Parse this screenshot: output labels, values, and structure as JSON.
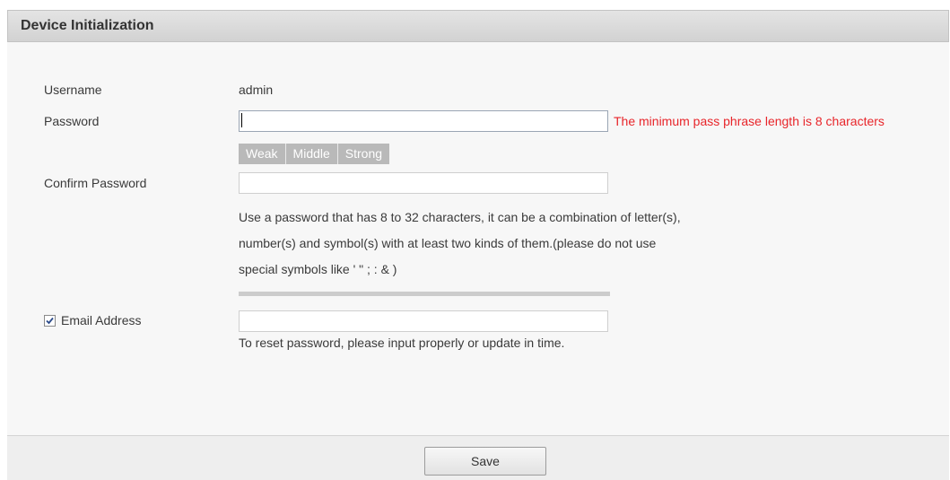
{
  "window": {
    "title": "Device Initialization"
  },
  "form": {
    "username": {
      "label": "Username",
      "value": "admin"
    },
    "password": {
      "label": "Password",
      "value": "",
      "error": "The minimum pass phrase length is 8 characters",
      "strength_levels": [
        "Weak",
        "Middle",
        "Strong"
      ]
    },
    "confirm_password": {
      "label": "Confirm Password",
      "value": ""
    },
    "hint_lines": [
      "Use a password that has 8 to 32 characters, it can be a combination of letter(s),",
      "number(s) and symbol(s) with at least two kinds of them.(please do not use",
      "special symbols like ' \" ; : & )"
    ],
    "email": {
      "label": "Email Address",
      "checked": true,
      "value": "",
      "hint": "To reset password, please input properly or update in time."
    }
  },
  "footer": {
    "save_label": "Save"
  },
  "colors": {
    "error": "#e8252a",
    "strength_bar": "#b9b9b9"
  }
}
